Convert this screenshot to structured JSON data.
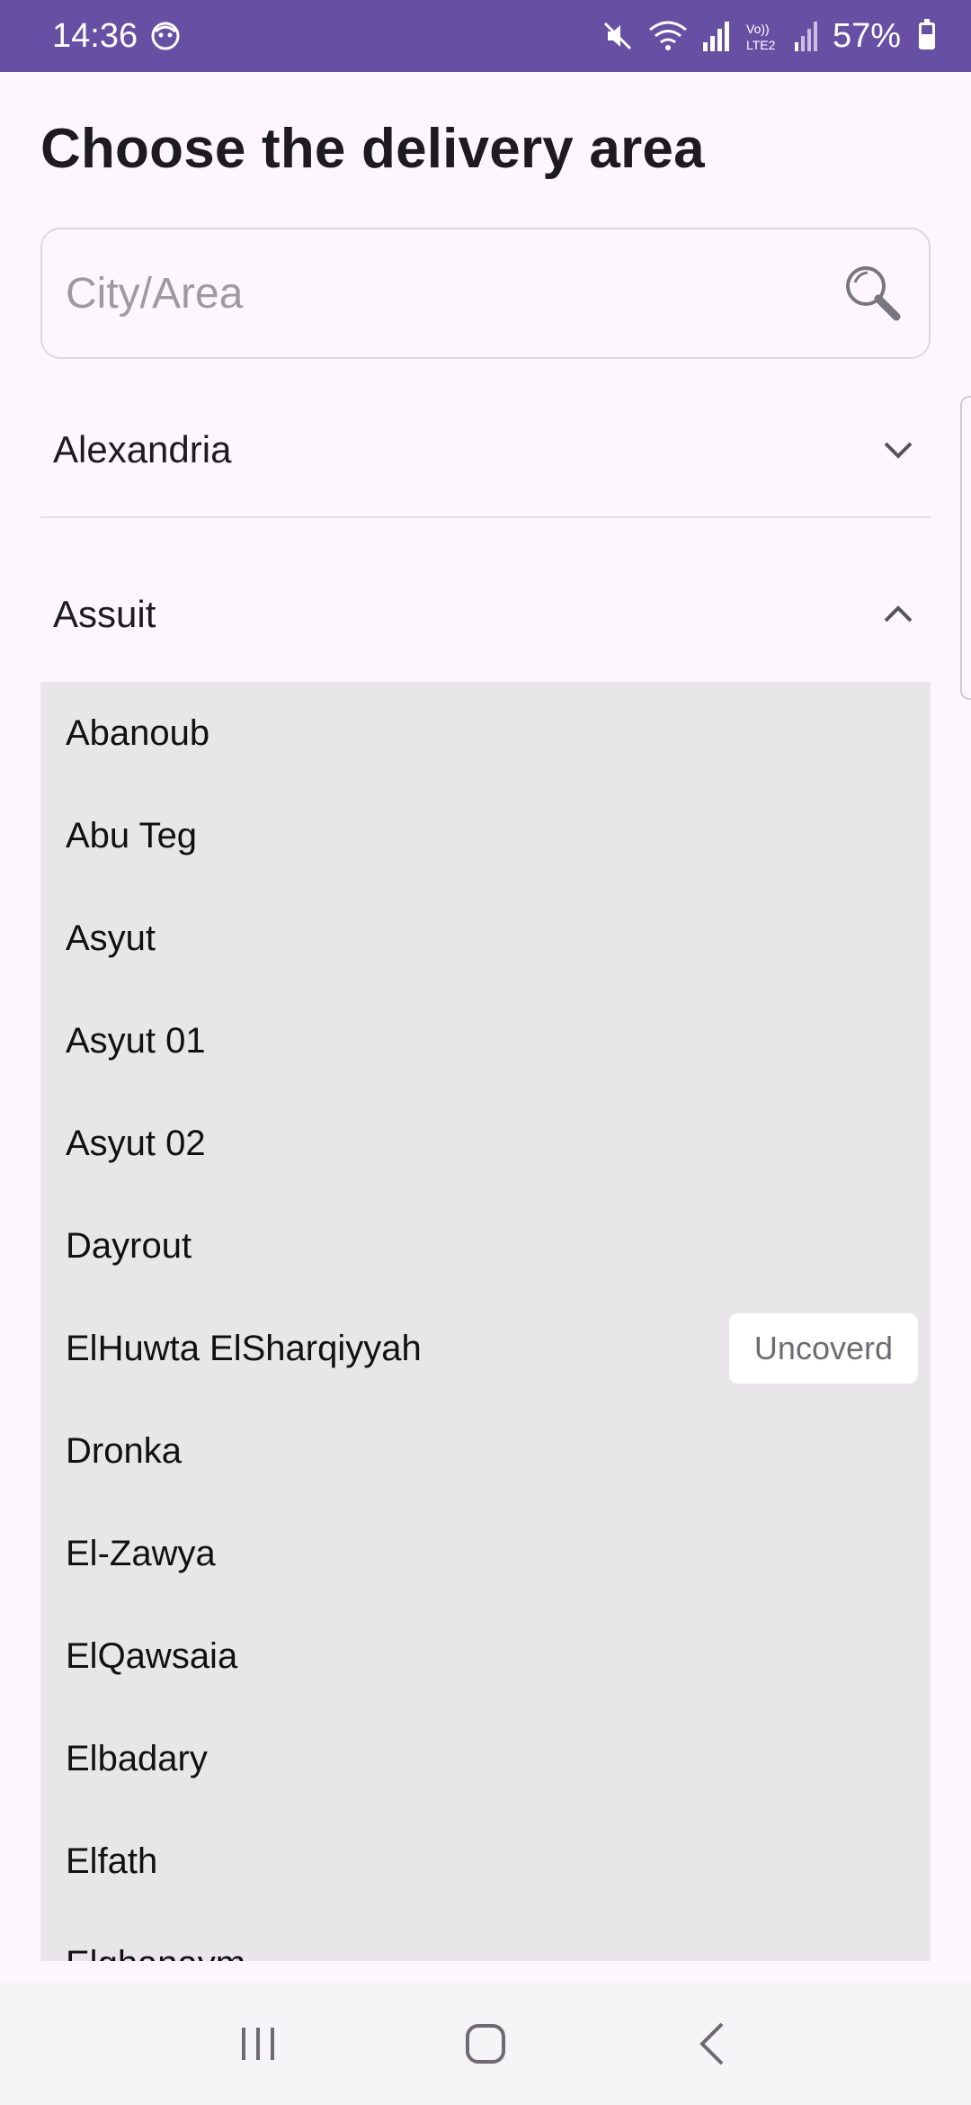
{
  "status_bar": {
    "time": "14:36",
    "battery": "57%"
  },
  "page": {
    "title": "Choose the delivery area"
  },
  "search": {
    "placeholder": "City/Area",
    "value": ""
  },
  "cities": [
    {
      "name": "Alexandria",
      "expanded": false
    },
    {
      "name": "Assuit",
      "expanded": true
    }
  ],
  "areas": [
    {
      "name": "Abanoub",
      "badge": ""
    },
    {
      "name": "Abu Teg",
      "badge": ""
    },
    {
      "name": "Asyut",
      "badge": ""
    },
    {
      "name": "Asyut 01",
      "badge": ""
    },
    {
      "name": "Asyut 02",
      "badge": ""
    },
    {
      "name": "Dayrout",
      "badge": ""
    },
    {
      "name": "ElHuwta ElSharqiyyah",
      "badge": "Uncoverd"
    },
    {
      "name": "Dronka",
      "badge": ""
    },
    {
      "name": "El-Zawya",
      "badge": ""
    },
    {
      "name": "ElQawsaia",
      "badge": ""
    },
    {
      "name": "Elbadary",
      "badge": ""
    },
    {
      "name": "Elfath",
      "badge": ""
    },
    {
      "name": "Elghanaym",
      "badge": ""
    }
  ],
  "colors": {
    "status_bar": "#6750a4",
    "background": "#fdf7fd",
    "list_background": "#e9e6ea",
    "badge_background": "#ffffff"
  },
  "icons": {
    "search": "search-icon",
    "expand": "chevron-down-icon",
    "collapse": "chevron-up-icon",
    "nav_recents": "recents-icon",
    "nav_home": "home-icon",
    "nav_back": "back-icon"
  }
}
